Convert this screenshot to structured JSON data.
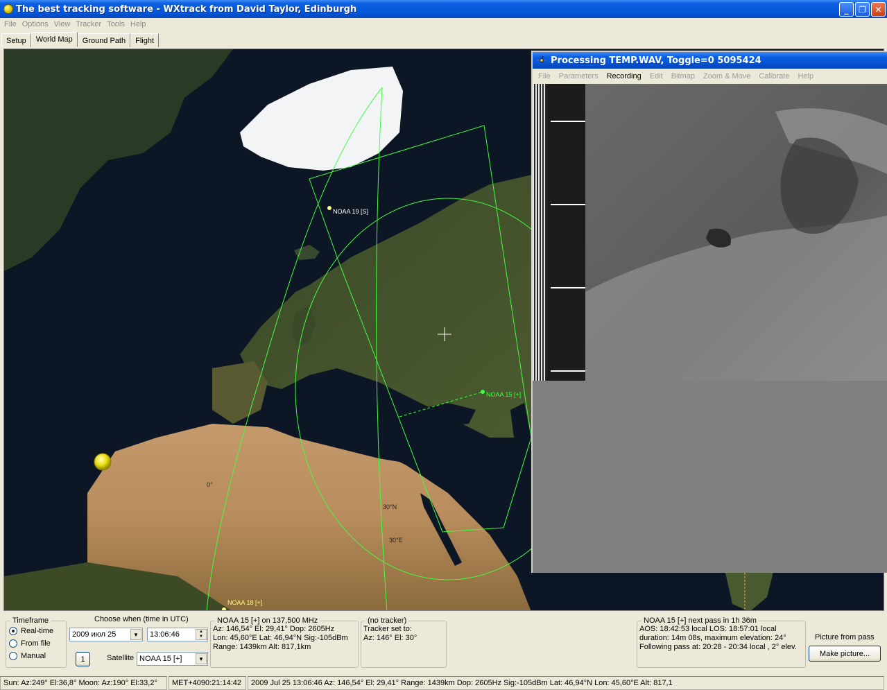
{
  "window": {
    "title": "The best tracking software - WXtrack from David Taylor, Edinburgh",
    "minimize": "_",
    "restore": "❐",
    "close": "✕"
  },
  "menu": [
    "File",
    "Options",
    "View",
    "Tracker",
    "Tools",
    "Help"
  ],
  "tabs": [
    "Setup",
    "World Map",
    "Ground Path",
    "Flight"
  ],
  "active_tab": "World Map",
  "map": {
    "satellites": [
      {
        "label": "NOAA 19 [S]",
        "color": "#ffff80"
      },
      {
        "label": "NOAA 15 [+]",
        "color": "#40ff40"
      },
      {
        "label": "NOAA 18 [+]",
        "color": "#ffff80"
      }
    ],
    "grid_labels": [
      "0°",
      "30°N",
      "30°E"
    ],
    "track_color": "#40ff40"
  },
  "processing": {
    "title": "Processing TEMP.WAV, Toggle=0 5095424",
    "menu": [
      "File",
      "Parameters",
      "Recording",
      "Edit",
      "Bitmap",
      "Zoom & Move",
      "Calibrate",
      "Help"
    ],
    "active_menu": "Recording"
  },
  "timeframe": {
    "legend": "Timeframe",
    "options": [
      "Real-time",
      "From file",
      "Manual"
    ],
    "selected": "Real-time"
  },
  "when": {
    "label": "Choose when (time in UTC)",
    "date": "2009 июл 25",
    "time": "13:06:46",
    "step_button": "1",
    "satellite_label": "Satellite",
    "satellite": "NOAA 15 [+]"
  },
  "sat_info": {
    "legend": "NOAA 15 [+] on 137,500 MHz",
    "lines": [
      "Az: 146,54°  El: 29,41°  Dop: 2605Hz",
      "Lon: 45,60°E  Lat: 46,94°N  Sig:-105dBm",
      "Range: 1439km  Alt: 817,1km"
    ]
  },
  "tracker": {
    "legend": "(no tracker)",
    "lines": [
      "Tracker set to:",
      "Az: 146°  El: 30°"
    ]
  },
  "next_pass": {
    "legend": "NOAA 15 [+] next pass in 1h 36m",
    "lines": [
      "AOS: 18:42:53 local  LOS: 18:57:01 local",
      "duration: 14m 08s,  maximum elevation: 24°",
      "Following pass at: 20:28 - 20:34 local , 2° elev."
    ]
  },
  "picture": {
    "label": "Picture from pass",
    "button": "Make picture..."
  },
  "status": [
    "Sun: Az:249° El:36,8°  Moon: Az:190° El:33,2°",
    "MET+4090:21:14:42",
    "2009 Jul 25  13:06:46  Az: 146,54°  El: 29,41°  Range: 1439km  Dop: 2605Hz  Sig:-105dBm  Lat: 46,94°N  Lon: 45,60°E  Alt: 817,1"
  ]
}
